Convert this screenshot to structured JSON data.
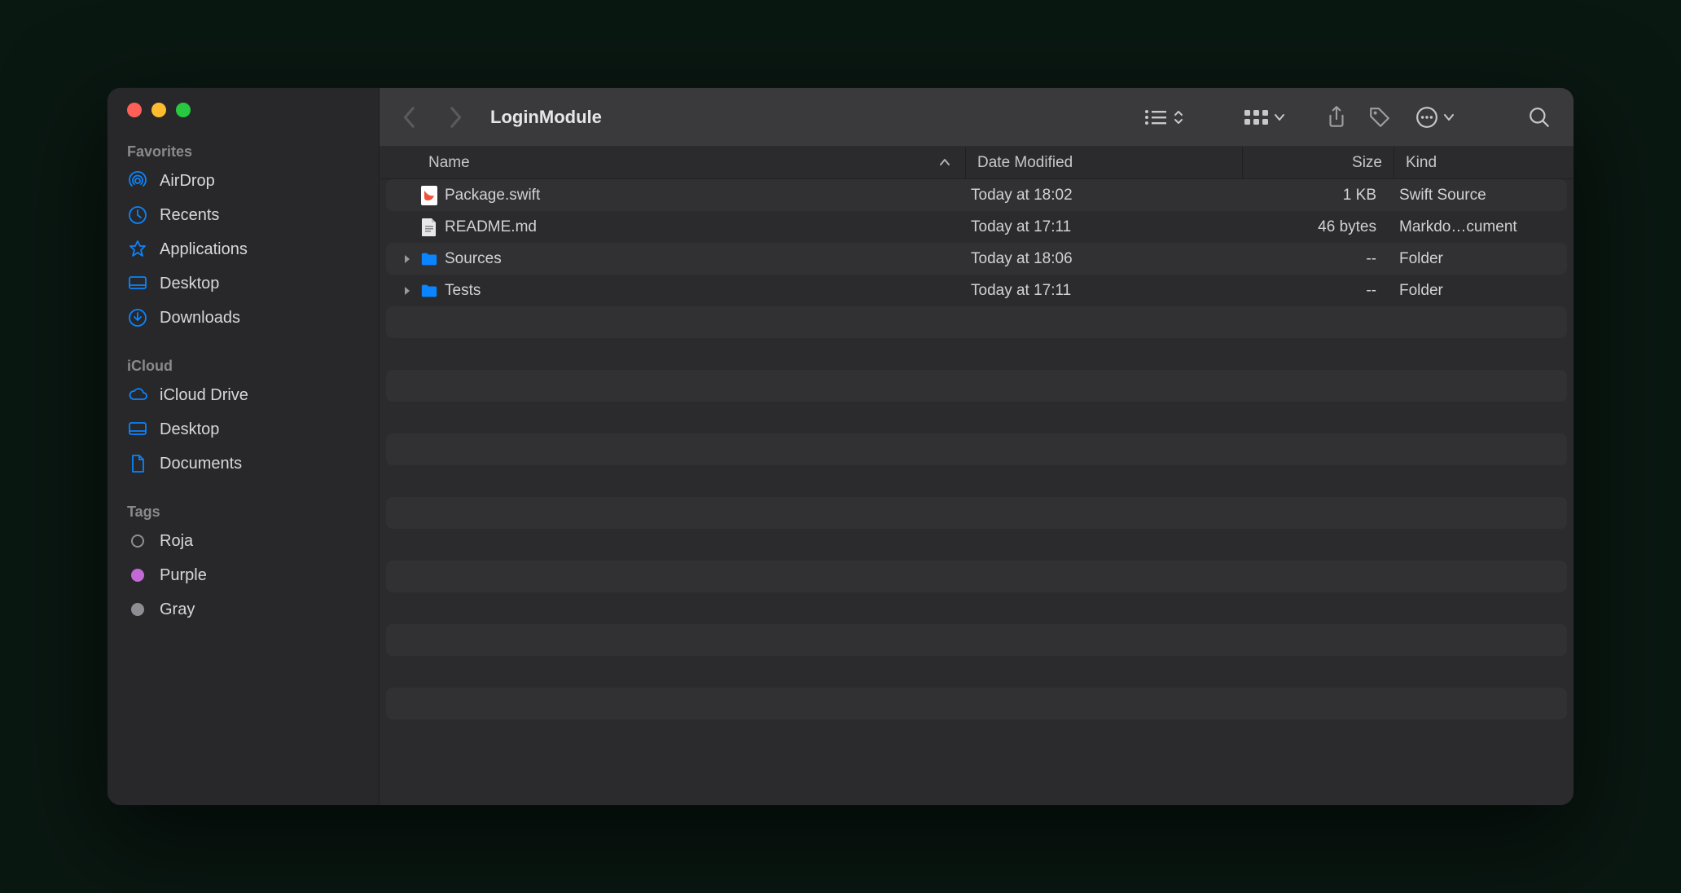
{
  "window": {
    "title": "LoginModule"
  },
  "sidebar": {
    "sections": [
      {
        "label": "Favorites",
        "items": [
          {
            "icon": "airdrop",
            "label": "AirDrop"
          },
          {
            "icon": "clock",
            "label": "Recents"
          },
          {
            "icon": "apps",
            "label": "Applications"
          },
          {
            "icon": "desktop",
            "label": "Desktop"
          },
          {
            "icon": "download",
            "label": "Downloads"
          }
        ]
      },
      {
        "label": "iCloud",
        "items": [
          {
            "icon": "cloud",
            "label": "iCloud Drive"
          },
          {
            "icon": "desktop",
            "label": "Desktop"
          },
          {
            "icon": "document",
            "label": "Documents"
          }
        ]
      },
      {
        "label": "Tags",
        "items": [
          {
            "icon": "tag",
            "color": "#8e8e93",
            "label": "Roja",
            "hollow": true
          },
          {
            "icon": "tag",
            "color": "#c369d6",
            "label": "Purple"
          },
          {
            "icon": "tag",
            "color": "#8e8e93",
            "label": "Gray"
          }
        ]
      }
    ]
  },
  "columns": {
    "name": "Name",
    "date": "Date Modified",
    "size": "Size",
    "kind": "Kind",
    "sort": "name-asc"
  },
  "files": [
    {
      "icon": "swift",
      "name": "Package.swift",
      "date": "Today at 18:02",
      "size": "1 KB",
      "kind": "Swift Source",
      "expandable": false
    },
    {
      "icon": "md",
      "name": "README.md",
      "date": "Today at 17:11",
      "size": "46 bytes",
      "kind": "Markdo…cument",
      "expandable": false
    },
    {
      "icon": "folder",
      "name": "Sources",
      "date": "Today at 18:06",
      "size": "--",
      "kind": "Folder",
      "expandable": true
    },
    {
      "icon": "folder",
      "name": "Tests",
      "date": "Today at 17:11",
      "size": "--",
      "kind": "Folder",
      "expandable": true
    }
  ],
  "emptyRows": 14
}
